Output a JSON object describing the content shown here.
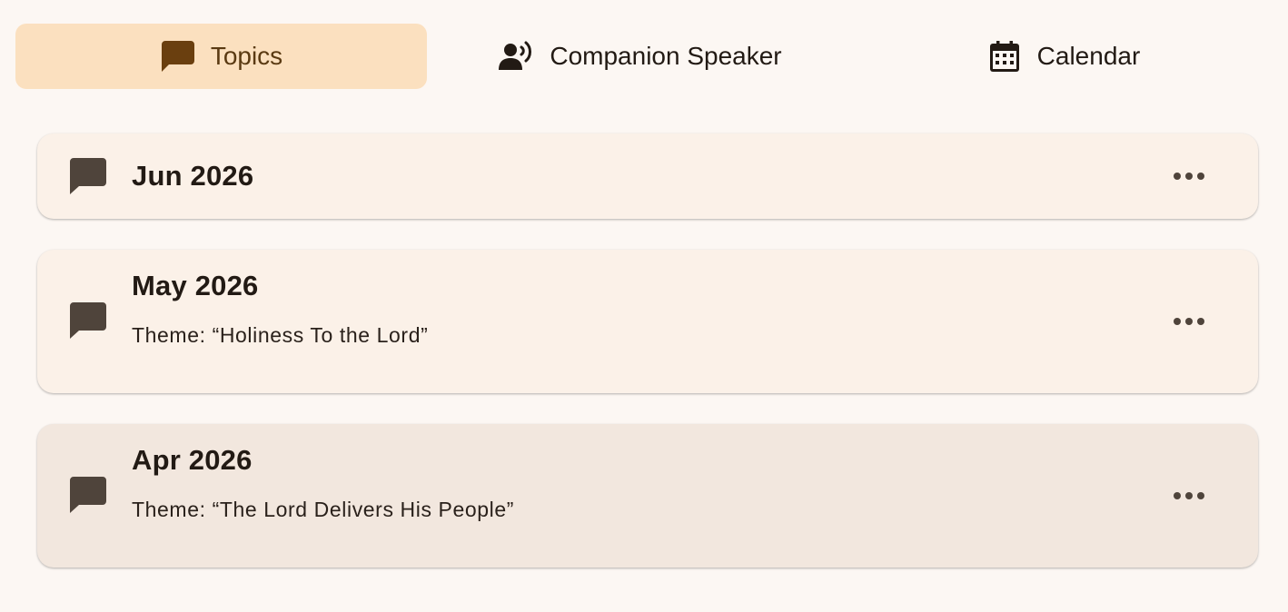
{
  "tabs": [
    {
      "label": "Topics",
      "icon": "chat-bubble-icon",
      "selected": true
    },
    {
      "label": "Companion Speaker",
      "icon": "record-voice-icon",
      "selected": false
    },
    {
      "label": "Calendar",
      "icon": "calendar-icon",
      "selected": false
    }
  ],
  "topics": [
    {
      "title": "Jun 2026",
      "subtitle": "",
      "icon": "chat-bubble-icon",
      "menu_icon": "more-horizontal-icon"
    },
    {
      "title": "May 2026",
      "subtitle": "Theme: “Holiness To the Lord”",
      "icon": "chat-bubble-icon",
      "menu_icon": "more-horizontal-icon"
    },
    {
      "title": "Apr 2026",
      "subtitle": "Theme: “The Lord Delivers His People”",
      "icon": "chat-bubble-icon",
      "menu_icon": "more-horizontal-icon"
    }
  ],
  "colors": {
    "background": "#fcf7f3",
    "selected_tab": "#fbe0bf",
    "selected_tab_icon": "#6a3f0f",
    "card": "#fbf1e8",
    "card_hover": "#f2e7de",
    "icon": "#4f443b",
    "text": "#221a14"
  }
}
